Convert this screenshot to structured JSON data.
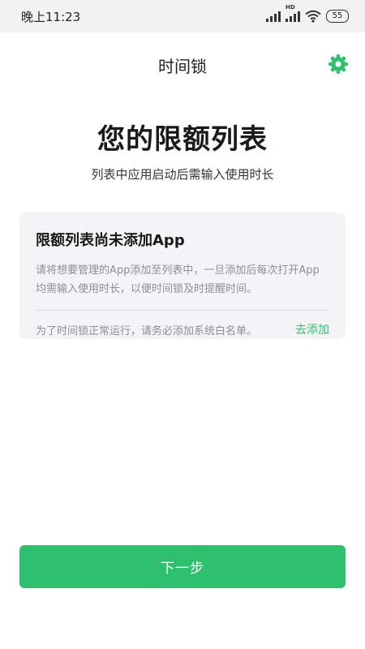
{
  "status_bar": {
    "time": "晚上11:23",
    "battery": "55",
    "hd_label": "HD"
  },
  "header": {
    "title": "时间锁",
    "settings_icon": "gear-icon"
  },
  "main": {
    "heading": "您的限额列表",
    "subheading": "列表中应用启动后需输入使用时长"
  },
  "card": {
    "title": "限额列表尚未添加App",
    "description": "请将想要管理的App添加至列表中，一旦添加后每次打开App均需输入使用时长，以便时间锁及时提醒时间。",
    "note": "为了时间锁正常运行，请务必添加系统白名单。",
    "link_label": "去添加"
  },
  "footer": {
    "next_label": "下一步"
  },
  "colors": {
    "accent": "#2ec06e",
    "card_bg": "#f4f4f6",
    "status_bg": "#f2f2f2"
  }
}
